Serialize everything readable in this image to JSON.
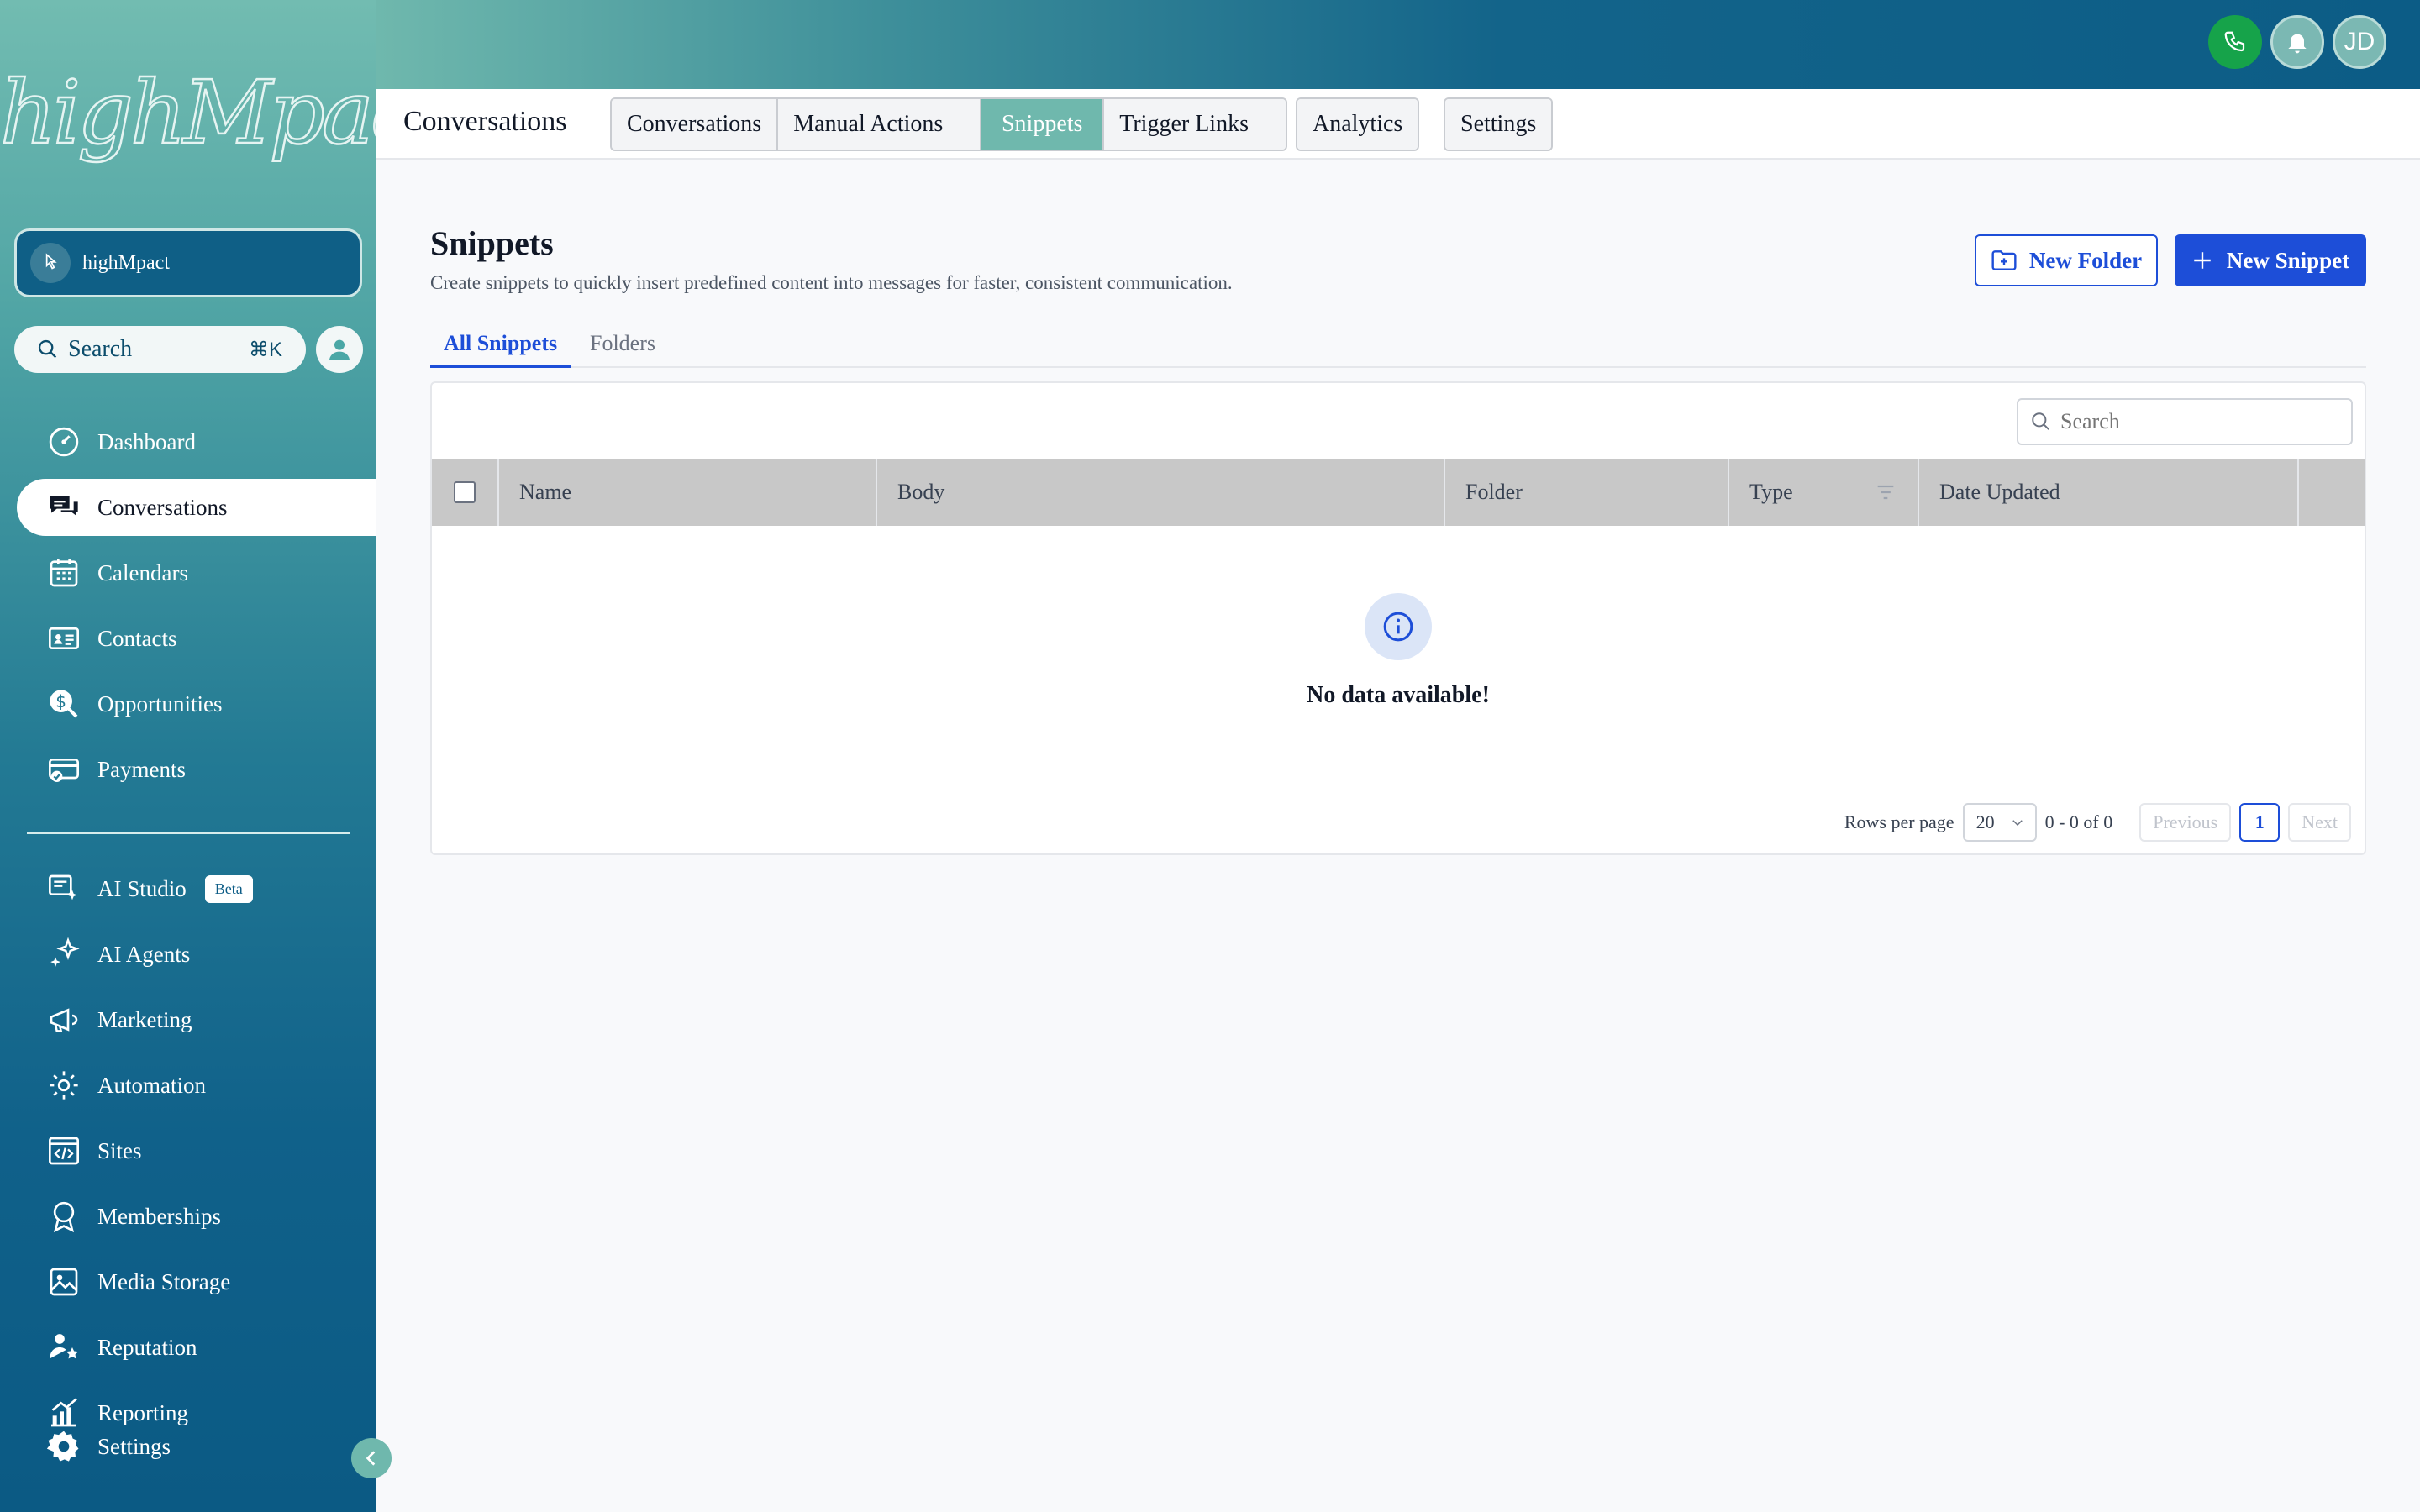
{
  "brand": {
    "logo_text": "highMpact"
  },
  "account": {
    "name": "highMpact"
  },
  "sidebar_search": {
    "label": "Search",
    "shortcut": "⌘K"
  },
  "nav": {
    "dashboard": "Dashboard",
    "conversations": "Conversations",
    "calendars": "Calendars",
    "contacts": "Contacts",
    "opportunities": "Opportunities",
    "payments": "Payments",
    "ai_studio": "AI Studio",
    "ai_studio_badge": "Beta",
    "ai_agents": "AI Agents",
    "marketing": "Marketing",
    "automation": "Automation",
    "sites": "Sites",
    "memberships": "Memberships",
    "media_storage": "Media Storage",
    "reputation": "Reputation",
    "reporting": "Reporting",
    "settings": "Settings"
  },
  "topbar": {
    "avatar_initials": "JD"
  },
  "header": {
    "title": "Conversations",
    "tabs": {
      "conversations": "Conversations",
      "manual_actions": "Manual Actions",
      "snippets": "Snippets",
      "trigger_links": "Trigger Links",
      "analytics": "Analytics",
      "settings": "Settings"
    }
  },
  "page": {
    "title": "Snippets",
    "subtitle": "Create snippets to quickly insert predefined content into messages for faster, consistent communication.",
    "new_folder": "New Folder",
    "new_snippet": "New Snippet",
    "subtabs": {
      "all": "All Snippets",
      "folders": "Folders"
    }
  },
  "table": {
    "search_placeholder": "Search",
    "columns": {
      "name": "Name",
      "body": "Body",
      "folder": "Folder",
      "type": "Type",
      "date_updated": "Date Updated"
    },
    "empty_message": "No data available!",
    "pagination": {
      "rows_label": "Rows per page",
      "rows_value": "20",
      "range": "0 - 0 of 0",
      "previous": "Previous",
      "page": "1",
      "next": "Next"
    }
  },
  "colors": {
    "accent": "#1d4ed8",
    "active_tab": "#6fb8ad",
    "call_button": "#16a34a"
  }
}
